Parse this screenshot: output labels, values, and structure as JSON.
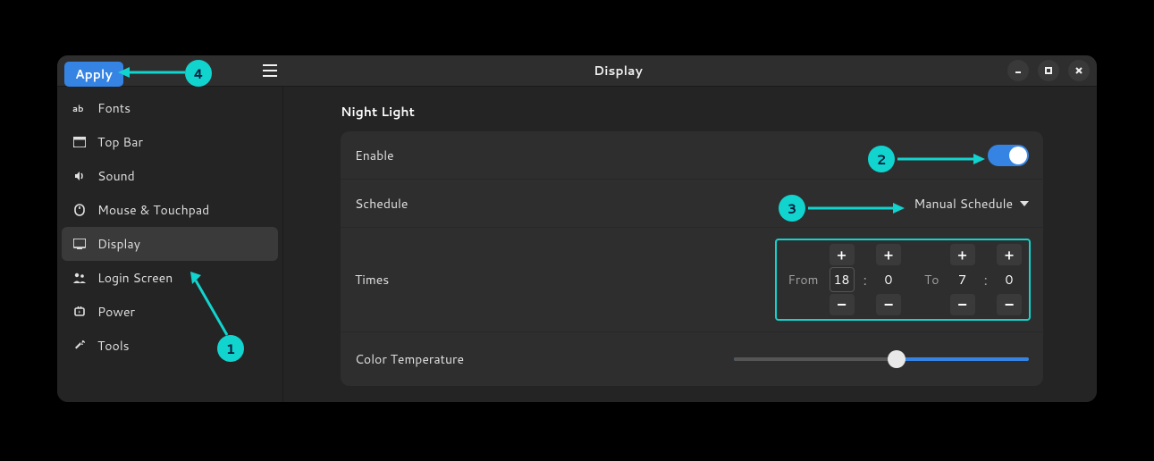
{
  "titlebar": {
    "apply_label": "Apply",
    "title": "Display"
  },
  "sidebar": {
    "items": [
      {
        "label": "Fonts",
        "icon": "ab-icon"
      },
      {
        "label": "Top Bar",
        "icon": "topbar-icon"
      },
      {
        "label": "Sound",
        "icon": "sound-icon"
      },
      {
        "label": "Mouse & Touchpad",
        "icon": "mouse-icon"
      },
      {
        "label": "Display",
        "icon": "display-icon",
        "active": true
      },
      {
        "label": "Login Screen",
        "icon": "login-icon"
      },
      {
        "label": "Power",
        "icon": "power-icon"
      },
      {
        "label": "Tools",
        "icon": "tools-icon"
      }
    ]
  },
  "main": {
    "section_title": "Night Light",
    "enable": {
      "label": "Enable",
      "value": true
    },
    "schedule": {
      "label": "Schedule",
      "selected": "Manual Schedule"
    },
    "times": {
      "label": "Times",
      "from_label": "From",
      "to_label": "To",
      "from_hour": "18",
      "from_min": "0",
      "to_hour": "7",
      "to_min": "0"
    },
    "color_temp": {
      "label": "Color Temperature",
      "percent": 55
    }
  },
  "annotations": {
    "c1": "1",
    "c2": "2",
    "c3": "3",
    "c4": "4"
  }
}
